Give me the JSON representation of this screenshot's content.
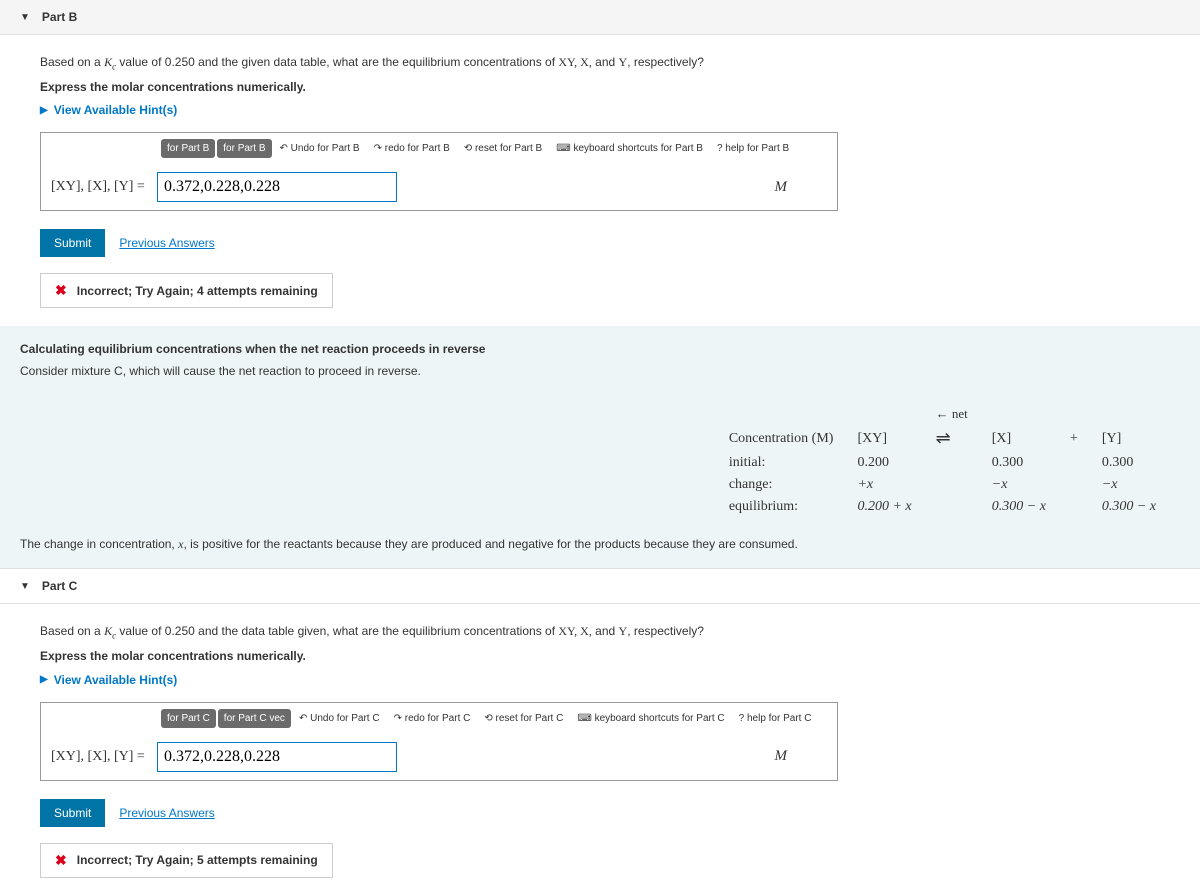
{
  "partB": {
    "title": "Part B",
    "prompt_pre": "Based on a ",
    "kc_label": "K",
    "kc_sub": "c",
    "prompt_mid1": " value of ",
    "kc_value": "0.250",
    "prompt_mid2": " and the given data table, what are the equilibrium concentrations of ",
    "species": "XY, X,",
    "prompt_and": " and ",
    "speciesY": "Y",
    "prompt_post": ", respectively?",
    "express": "Express the molar concentrations numerically.",
    "hints": "View Available Hint(s)",
    "toolbar": {
      "btn1": "for Part B",
      "btn2": "for Part B",
      "undo": "Undo for Part B",
      "redo": "redo for Part B",
      "reset": "reset for Part B",
      "kbd": "keyboard shortcuts for Part B",
      "help": "help for Part B"
    },
    "answer_label": "[XY], [X], [Y] =",
    "answer_value": "0.372,0.228,0.228",
    "unit": "M",
    "submit": "Submit",
    "prev": "Previous Answers",
    "feedback": "Incorrect; Try Again; 4 attempts remaining"
  },
  "explain": {
    "heading": "Calculating equilibrium concentrations when the net reaction proceeds in reverse",
    "line1": "Consider mixture C, which will cause the net reaction to proceed in reverse.",
    "net_label": "← net",
    "table": {
      "h0": "Concentration (M)",
      "h1": "[XY]",
      "harr": "⇌",
      "h2": "[X]",
      "hplus": "+",
      "h3": "[Y]",
      "r1": "initial:",
      "r1v1": "0.200",
      "r1v2": "0.300",
      "r1v3": "0.300",
      "r2": "change:",
      "r2v1": "+x",
      "r2v2": "−x",
      "r2v3": "−x",
      "r3": "equilibrium:",
      "r3v1": "0.200 + x",
      "r3v2": "0.300 − x",
      "r3v3": "0.300 − x"
    },
    "note_pre": "The change in concentration, ",
    "note_x": "x",
    "note_post": ", is positive for the reactants because they are produced and negative for the products because they are consumed."
  },
  "partC": {
    "title": "Part C",
    "prompt_pre": "Based on a ",
    "kc_label": "K",
    "kc_sub": "c",
    "prompt_mid1": " value of ",
    "kc_value": "0.250",
    "prompt_mid2": " and the data table given, what are the equilibrium concentrations of ",
    "species": "XY, X,",
    "prompt_and": " and ",
    "speciesY": "Y",
    "prompt_post": ", respectively?",
    "express": "Express the molar concentrations numerically.",
    "hints": "View Available Hint(s)",
    "toolbar": {
      "btn1": "for Part C",
      "btn2": "for Part C",
      "vec": "vec",
      "undo": "Undo for Part C",
      "redo": "redo for Part C",
      "reset": "reset for Part C",
      "kbd": "keyboard shortcuts for Part C",
      "help": "help for Part C"
    },
    "answer_label": "[XY], [X], [Y] =",
    "answer_value": "0.372,0.228,0.228",
    "unit": "M",
    "submit": "Submit",
    "prev": "Previous Answers",
    "feedback": "Incorrect; Try Again; 5 attempts remaining"
  }
}
